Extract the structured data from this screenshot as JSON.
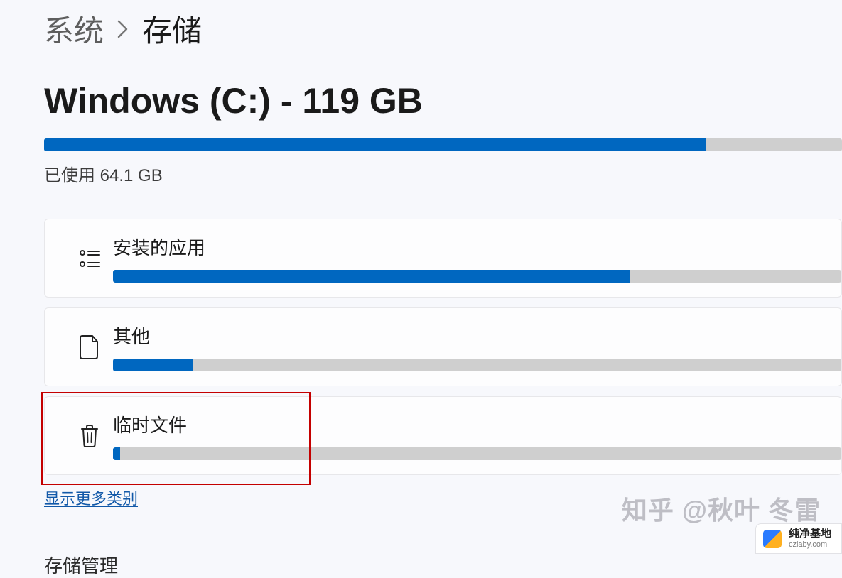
{
  "breadcrumb": {
    "parent": "系统",
    "current": "存储"
  },
  "drive": {
    "title": "Windows (C:) - 119 GB",
    "used_label": "已使用 64.1 GB",
    "used_percent": 83
  },
  "categories": [
    {
      "name": "安装的应用",
      "icon": "apps-list-icon",
      "percent": 71
    },
    {
      "name": "其他",
      "icon": "file-icon",
      "percent": 11
    },
    {
      "name": "临时文件",
      "icon": "trash-icon",
      "percent": 1,
      "highlighted": true
    }
  ],
  "show_more": "显示更多类别",
  "section_heading": "存储管理",
  "watermark": {
    "zhihu": "知乎 @秋叶 冬雷",
    "logo_title": "纯净基地",
    "logo_sub": "czlaby.com"
  },
  "colors": {
    "accent": "#0067c0",
    "highlight_border": "#c40000"
  }
}
